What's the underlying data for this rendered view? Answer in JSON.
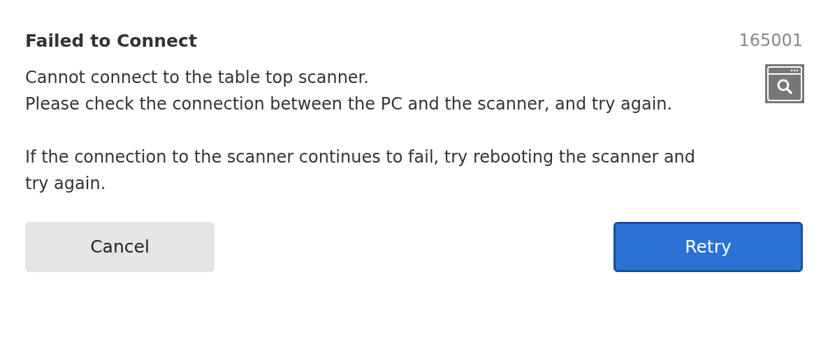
{
  "dialog": {
    "title": "Failed to Connect",
    "code": "165001",
    "paragraphs": [
      [
        "Cannot connect to the table top scanner.",
        "Please check the connection between the PC and the scanner, and try again."
      ],
      [
        "If the connection to the scanner continues to fail, try rebooting the scanner and try again."
      ]
    ],
    "buttons": [
      {
        "label": "Cancel",
        "kind": "secondary"
      },
      {
        "label": "Retry",
        "kind": "primary"
      }
    ]
  }
}
